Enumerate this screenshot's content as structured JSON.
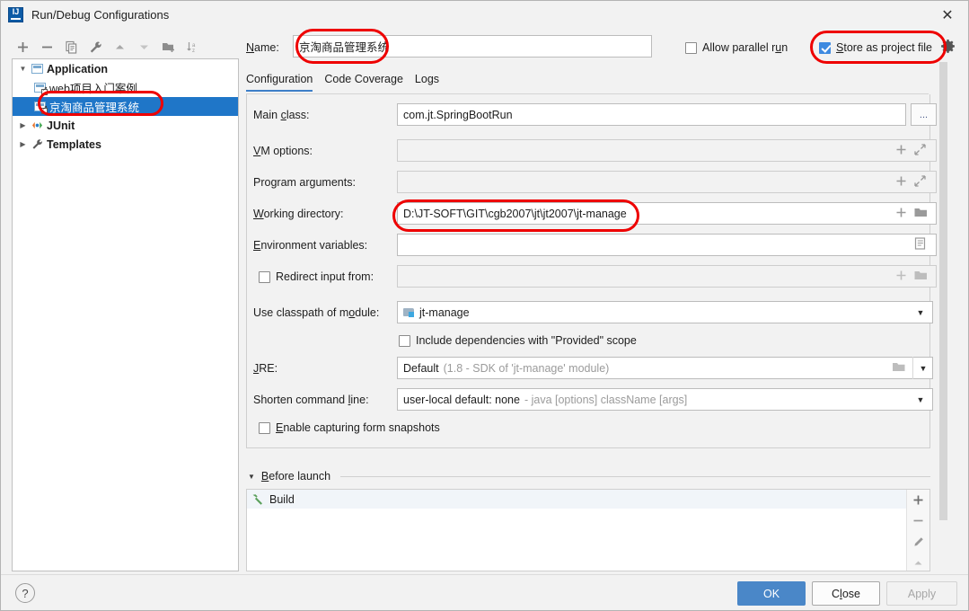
{
  "window": {
    "title": "Run/Debug Configurations",
    "logo_icon": "intellij-idea-logo",
    "close_icon": "✕"
  },
  "left_toolbar": {
    "buttons": [
      {
        "name": "add",
        "icon": "plus-icon"
      },
      {
        "name": "remove",
        "icon": "minus-icon"
      },
      {
        "name": "copy",
        "icon": "copy-icon"
      },
      {
        "name": "edit-templates",
        "icon": "wrench-icon"
      },
      {
        "name": "move-up",
        "icon": "arrow-up-icon"
      },
      {
        "name": "move-down",
        "icon": "arrow-down-icon"
      },
      {
        "name": "new-folder",
        "icon": "folder-add-icon"
      },
      {
        "name": "sort-alphabetically",
        "icon": "sort-az-icon"
      }
    ]
  },
  "tree": {
    "nodes": [
      {
        "label": "Application",
        "icon": "application-icon",
        "expanded": true,
        "bold": true,
        "level": 0,
        "selected": false
      },
      {
        "label": "web项目入门案例",
        "icon": "run-config-icon",
        "level": 1,
        "selected": false
      },
      {
        "label": "京淘商品管理系统",
        "icon": "run-config-icon",
        "level": 1,
        "selected": true
      },
      {
        "label": "JUnit",
        "icon": "junit-icon",
        "expanded": false,
        "bold": true,
        "level": 0,
        "selected": false
      },
      {
        "label": "Templates",
        "icon": "wrench-icon",
        "expanded": false,
        "bold": true,
        "level": 0,
        "selected": false
      }
    ]
  },
  "header": {
    "name_label": "Name:",
    "name_value": "京淘商品管理系统",
    "allow_parallel_run_label": "Allow parallel run",
    "allow_parallel_run_checked": false,
    "store_as_project_file_label": "Store as project file",
    "store_as_project_file_checked": true,
    "gear_icon": "gear-icon"
  },
  "tabs": [
    {
      "label": "Configuration",
      "active": true
    },
    {
      "label": "Code Coverage",
      "active": false
    },
    {
      "label": "Logs",
      "active": false
    }
  ],
  "configuration": {
    "main_class": {
      "label": "Main class:",
      "value": "com.jt.SpringBootRun",
      "browse_label": "..."
    },
    "vm_options": {
      "label": "VM options:",
      "value": "",
      "icons": [
        "plus-icon",
        "expand-icon"
      ]
    },
    "program_arguments": {
      "label": "Program arguments:",
      "value": "",
      "icons": [
        "plus-icon",
        "expand-icon"
      ]
    },
    "working_directory": {
      "label": "Working directory:",
      "value": "D:\\JT-SOFT\\GIT\\cgb2007\\jt\\jt2007\\jt-manage",
      "icons": [
        "plus-icon",
        "folder-icon"
      ]
    },
    "environment_variables": {
      "label": "Environment variables:",
      "value": "",
      "icons": [
        "list-icon"
      ]
    },
    "redirect_input_from": {
      "label": "Redirect input from:",
      "checked": false,
      "value": "",
      "icons": [
        "plus-icon",
        "folder-icon"
      ]
    },
    "use_classpath_of_module": {
      "label": "Use classpath of module:",
      "value": "jt-manage",
      "module_icon": "module-icon",
      "arrow_icon": "chevron-down-icon"
    },
    "include_provided_scope": {
      "label": "Include dependencies with \"Provided\" scope",
      "checked": false
    },
    "jre": {
      "label": "JRE:",
      "value": "Default",
      "hint": "(1.8 - SDK of 'jt-manage' module)",
      "icons": [
        "folder-icon",
        "chevron-down-icon"
      ]
    },
    "shorten_command_line": {
      "label": "Shorten command line:",
      "value": "user-local default: none",
      "hint": "- java [options] className [args]",
      "arrow_icon": "chevron-down-icon"
    },
    "enable_form_snapshots": {
      "label": "Enable capturing form snapshots",
      "checked": false
    }
  },
  "before_launch": {
    "title": "Before launch",
    "collapse_icon": "chevron-down-icon",
    "items": [
      {
        "label": "Build",
        "icon": "hammer-icon"
      }
    ],
    "side_buttons": [
      {
        "name": "add",
        "icon": "plus-icon"
      },
      {
        "name": "remove",
        "icon": "minus-icon"
      },
      {
        "name": "edit",
        "icon": "pencil-icon"
      },
      {
        "name": "move-up",
        "icon": "arrow-up-icon"
      }
    ]
  },
  "footer": {
    "help_label": "?",
    "ok_label": "OK",
    "close_label": "Close",
    "apply_label": "Apply",
    "apply_enabled": false
  },
  "colors": {
    "accent": "#4a87c8",
    "selection": "#1f76c8",
    "annotation": "#ee0000",
    "checkbox_checked": "#3e8ae0",
    "window_bg": "#f2f2f2"
  },
  "annotations": [
    {
      "name": "name-field-highlight",
      "target": "header.name_value"
    },
    {
      "name": "store-as-project-file-highlight",
      "target": "header.store_as_project_file_label"
    },
    {
      "name": "selected-config-highlight",
      "target": "tree.nodes.2.label"
    },
    {
      "name": "working-directory-highlight",
      "target": "configuration.working_directory.value"
    }
  ]
}
